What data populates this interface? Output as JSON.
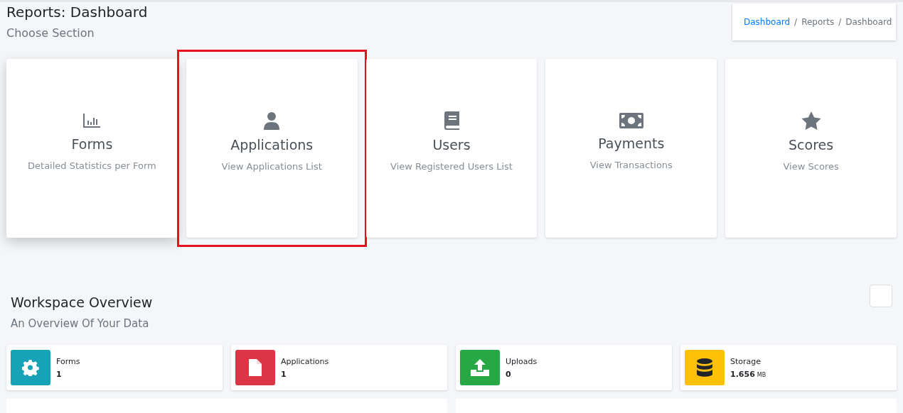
{
  "header": {
    "title": "Reports: Dashboard",
    "subtitle": "Choose Section"
  },
  "breadcrumb": [
    {
      "label": "Dashboard",
      "link": true
    },
    {
      "separator": "/",
      "label": "Reports",
      "link": false
    },
    {
      "separator": "/",
      "label": "Dashboard",
      "link": false
    }
  ],
  "sections": [
    {
      "kind": "chart",
      "title": "Forms",
      "description": "Detailed Statistics per Form",
      "highlighted": false,
      "hovered": true
    },
    {
      "kind": "user",
      "title": "Applications",
      "description": "View Applications List",
      "highlighted": true,
      "hovered": false
    },
    {
      "kind": "book",
      "title": "Users",
      "description": "View Registered Users List",
      "highlighted": false,
      "hovered": false
    },
    {
      "kind": "money",
      "title": "Payments",
      "description": "View Transactions",
      "highlighted": false,
      "hovered": false
    },
    {
      "kind": "star",
      "title": "Scores",
      "description": "View Scores",
      "highlighted": false,
      "hovered": false
    }
  ],
  "overview": {
    "title": "Workspace Overview",
    "subtitle": "An Overview Of Your Data",
    "stats": [
      {
        "kind": "gear",
        "label": "Forms",
        "value": "1",
        "color": "#17a2b8"
      },
      {
        "kind": "file",
        "label": "Applications",
        "value": "1",
        "color": "#dc3545"
      },
      {
        "kind": "upload",
        "label": "Uploads",
        "value": "0",
        "color": "#28a745"
      },
      {
        "kind": "database",
        "label": "Storage",
        "value": "1.656",
        "unit": "MB",
        "color": "#ffc107"
      }
    ]
  }
}
